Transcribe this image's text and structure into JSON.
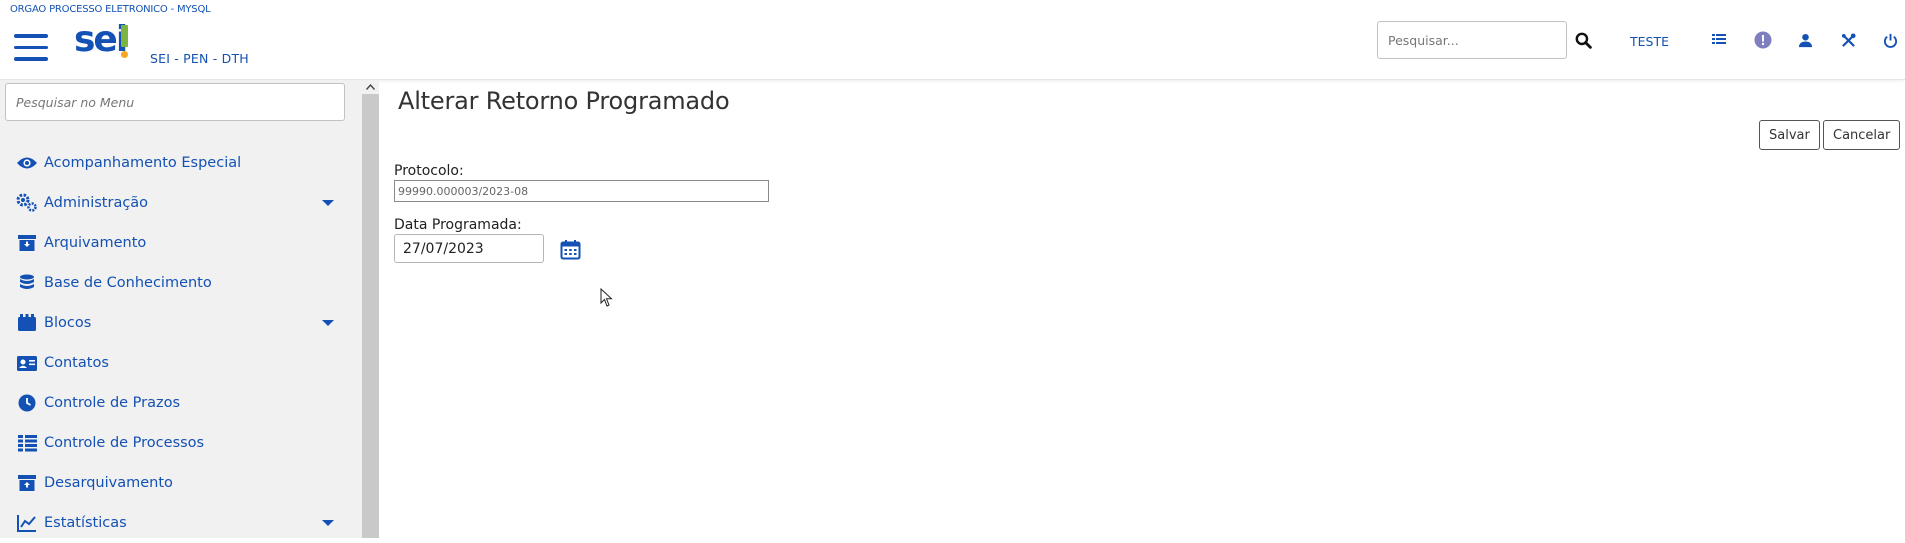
{
  "header": {
    "org_name": "ORGAO PROCESSO ELETRONICO - MYSQL",
    "logo_text": "sei",
    "system_name": "SEI - PEN - DTH",
    "search_placeholder": "Pesquisar...",
    "unit_name": "TESTE",
    "icons": [
      "menu-icon",
      "search-icon",
      "grid-icon",
      "info-icon",
      "user-icon",
      "tools-icon",
      "power-icon"
    ],
    "accent_color": "#1351b4"
  },
  "sidebar": {
    "search_placeholder": "Pesquisar no Menu",
    "items": [
      {
        "label": "Acompanhamento Especial",
        "icon": "eye-icon",
        "has_submenu": false
      },
      {
        "label": "Administração",
        "icon": "gears-icon",
        "has_submenu": true
      },
      {
        "label": "Arquivamento",
        "icon": "archive-icon",
        "has_submenu": false
      },
      {
        "label": "Base de Conhecimento",
        "icon": "database-icon",
        "has_submenu": false
      },
      {
        "label": "Blocos",
        "icon": "book-icon",
        "has_submenu": true
      },
      {
        "label": "Contatos",
        "icon": "contact-card-icon",
        "has_submenu": false
      },
      {
        "label": "Controle de Prazos",
        "icon": "clock-icon",
        "has_submenu": false
      },
      {
        "label": "Controle de Processos",
        "icon": "list-icon",
        "has_submenu": false
      },
      {
        "label": "Desarquivamento",
        "icon": "unarchive-icon",
        "has_submenu": false
      },
      {
        "label": "Estatísticas",
        "icon": "chart-line-icon",
        "has_submenu": true
      }
    ]
  },
  "main": {
    "title": "Alterar Retorno Programado",
    "buttons": {
      "save": "Salvar",
      "cancel": "Cancelar"
    },
    "fields": {
      "protocolo_label": "Protocolo:",
      "protocolo_value": "99990.000003/2023-08",
      "data_label": "Data Programada:",
      "data_value": "27/07/2023"
    }
  }
}
